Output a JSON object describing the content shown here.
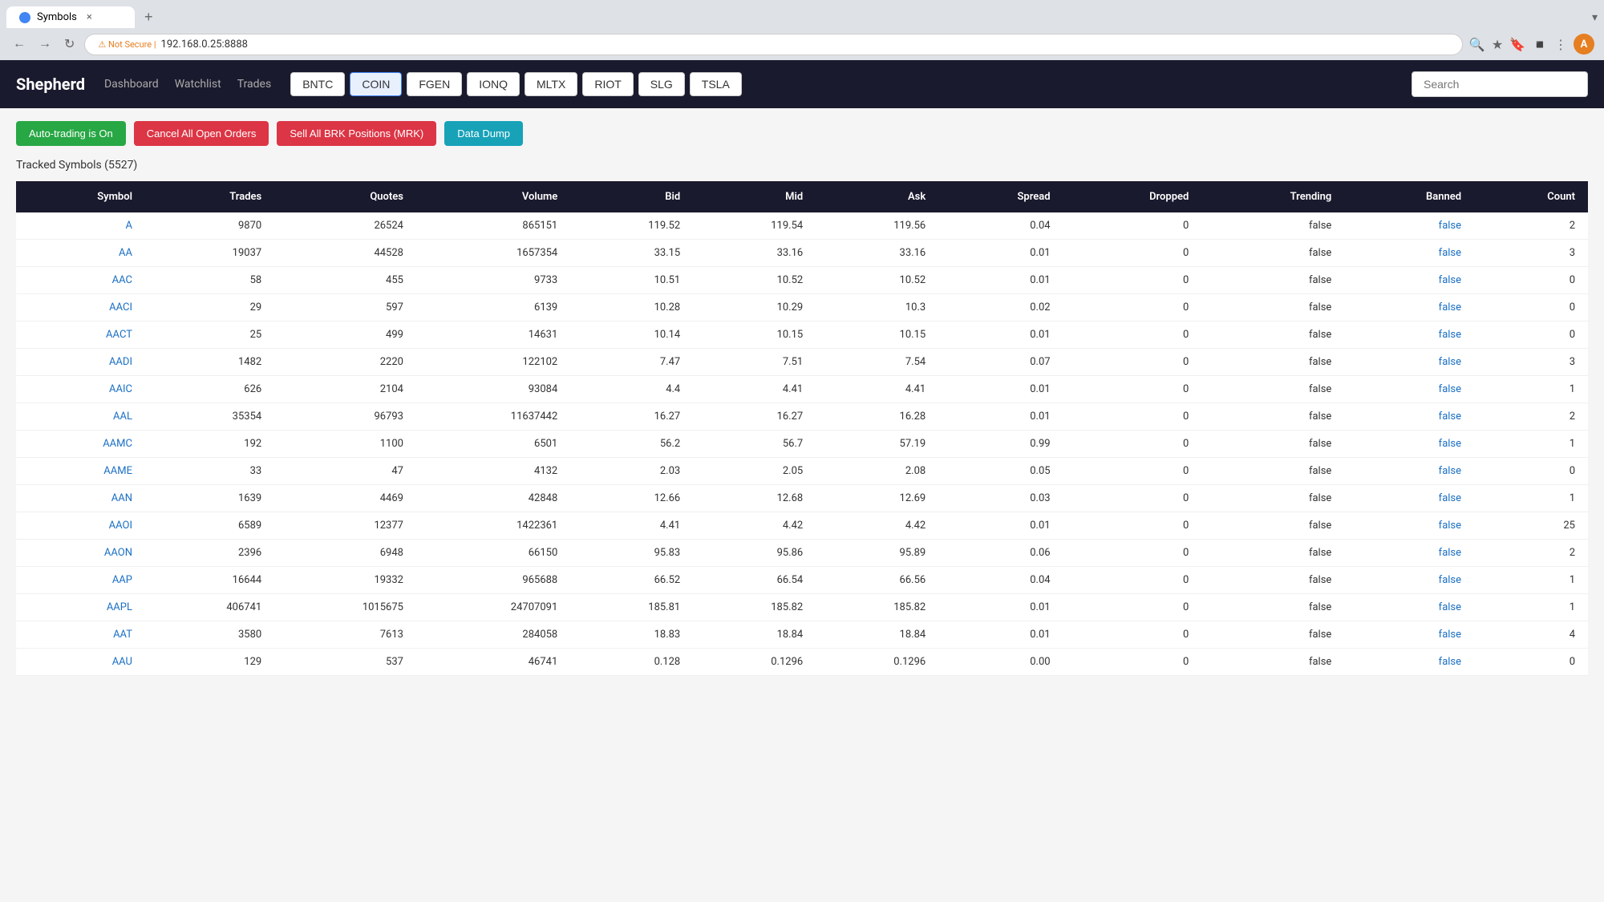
{
  "browser": {
    "tab_label": "Symbols",
    "tab_close": "×",
    "tab_new": "+",
    "address_warning": "Not Secure",
    "address_url": "192.168.0.25:8888",
    "profile_initial": "A"
  },
  "header": {
    "logo": "Shepherd",
    "nav": [
      "Dashboard",
      "Watchlist",
      "Trades"
    ],
    "symbol_tabs": [
      "BNTC",
      "COIN",
      "FGEN",
      "IONQ",
      "MLTX",
      "RIOT",
      "SLG",
      "TSLA"
    ],
    "search_placeholder": "Search"
  },
  "actions": {
    "auto_trading": "Auto-trading is On",
    "cancel_orders": "Cancel All Open Orders",
    "sell_positions": "Sell All BRK Positions (MRK)",
    "data_dump": "Data Dump"
  },
  "tracked_title": "Tracked Symbols (5527)",
  "table": {
    "columns": [
      "Symbol",
      "Trades",
      "Quotes",
      "Volume",
      "Bid",
      "Mid",
      "Ask",
      "Spread",
      "Dropped",
      "Trending",
      "Banned",
      "Count"
    ],
    "rows": [
      [
        "A",
        "9870",
        "26524",
        "865151",
        "119.52",
        "119.54",
        "119.56",
        "0.04",
        "0",
        "false",
        "false",
        "2"
      ],
      [
        "AA",
        "19037",
        "44528",
        "1657354",
        "33.15",
        "33.16",
        "33.16",
        "0.01",
        "0",
        "false",
        "false",
        "3"
      ],
      [
        "AAC",
        "58",
        "455",
        "9733",
        "10.51",
        "10.52",
        "10.52",
        "0.01",
        "0",
        "false",
        "false",
        "0"
      ],
      [
        "AACI",
        "29",
        "597",
        "6139",
        "10.28",
        "10.29",
        "10.3",
        "0.02",
        "0",
        "false",
        "false",
        "0"
      ],
      [
        "AACT",
        "25",
        "499",
        "14631",
        "10.14",
        "10.15",
        "10.15",
        "0.01",
        "0",
        "false",
        "false",
        "0"
      ],
      [
        "AADI",
        "1482",
        "2220",
        "122102",
        "7.47",
        "7.51",
        "7.54",
        "0.07",
        "0",
        "false",
        "false",
        "3"
      ],
      [
        "AAIC",
        "626",
        "2104",
        "93084",
        "4.4",
        "4.41",
        "4.41",
        "0.01",
        "0",
        "false",
        "false",
        "1"
      ],
      [
        "AAL",
        "35354",
        "96793",
        "11637442",
        "16.27",
        "16.27",
        "16.28",
        "0.01",
        "0",
        "false",
        "false",
        "2"
      ],
      [
        "AAMC",
        "192",
        "1100",
        "6501",
        "56.2",
        "56.7",
        "57.19",
        "0.99",
        "0",
        "false",
        "false",
        "1"
      ],
      [
        "AAME",
        "33",
        "47",
        "4132",
        "2.03",
        "2.05",
        "2.08",
        "0.05",
        "0",
        "false",
        "false",
        "0"
      ],
      [
        "AAN",
        "1639",
        "4469",
        "42848",
        "12.66",
        "12.68",
        "12.69",
        "0.03",
        "0",
        "false",
        "false",
        "1"
      ],
      [
        "AAOI",
        "6589",
        "12377",
        "1422361",
        "4.41",
        "4.42",
        "4.42",
        "0.01",
        "0",
        "false",
        "false",
        "25"
      ],
      [
        "AAON",
        "2396",
        "6948",
        "66150",
        "95.83",
        "95.86",
        "95.89",
        "0.06",
        "0",
        "false",
        "false",
        "2"
      ],
      [
        "AAP",
        "16644",
        "19332",
        "965688",
        "66.52",
        "66.54",
        "66.56",
        "0.04",
        "0",
        "false",
        "false",
        "1"
      ],
      [
        "AAPL",
        "406741",
        "1015675",
        "24707091",
        "185.81",
        "185.82",
        "185.82",
        "0.01",
        "0",
        "false",
        "false",
        "1"
      ],
      [
        "AAT",
        "3580",
        "7613",
        "284058",
        "18.83",
        "18.84",
        "18.84",
        "0.01",
        "0",
        "false",
        "false",
        "4"
      ],
      [
        "AAU",
        "129",
        "537",
        "46741",
        "0.128",
        "0.1296",
        "0.1296",
        "0.00",
        "0",
        "false",
        "false",
        "0"
      ]
    ]
  }
}
